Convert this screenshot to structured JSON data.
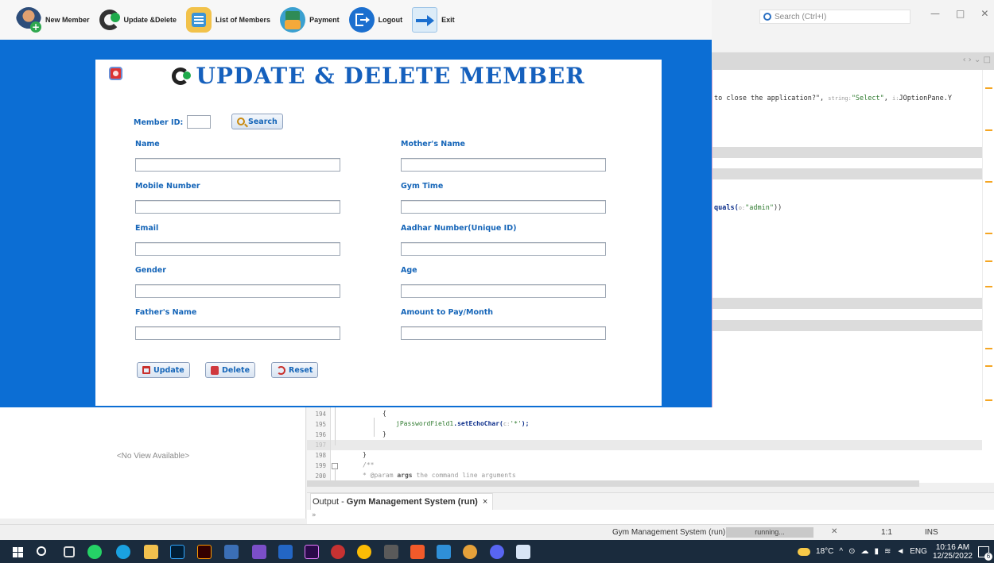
{
  "app_toolbar": {
    "buttons": [
      {
        "label": "New Member",
        "icon": "add-user-icon"
      },
      {
        "label": "Update &Delete",
        "icon": "refresh-icon"
      },
      {
        "label": "List of Members",
        "icon": "list-icon"
      },
      {
        "label": "Payment",
        "icon": "money-icon"
      },
      {
        "label": "Logout",
        "icon": "logout-icon"
      },
      {
        "label": "Exit",
        "icon": "exit-arrow-icon"
      }
    ]
  },
  "dialog": {
    "title": "UPDATE & DELETE MEMBER",
    "member_id_label": "Member ID:",
    "member_id_value": "",
    "search_button": "Search",
    "fields": {
      "name": {
        "label": "Name",
        "value": ""
      },
      "mothers_name": {
        "label": "Mother's Name",
        "value": ""
      },
      "mobile": {
        "label": "Mobile Number",
        "value": ""
      },
      "gym_time": {
        "label": "Gym Time",
        "value": ""
      },
      "email": {
        "label": "Email",
        "value": ""
      },
      "aadhar": {
        "label": "Aadhar Number(Unique ID)",
        "value": ""
      },
      "gender": {
        "label": "Gender",
        "value": ""
      },
      "age": {
        "label": "Age",
        "value": ""
      },
      "fathers_name": {
        "label": "Father's Name",
        "value": ""
      },
      "amount": {
        "label": "Amount to Pay/Month",
        "value": ""
      }
    },
    "buttons": {
      "update": "Update",
      "delete": "Delete",
      "reset": "Reset"
    }
  },
  "ide": {
    "search_placeholder": "Search (Ctrl+I)",
    "code_right": {
      "line1_pre": "to close the application?\", ",
      "line1_hint": "string:",
      "line1_str": "\"Select\"",
      "line1_post": ", ",
      "line1_hint2": "i:",
      "line1_tail": "JOptionPane.Y",
      "line2_pre": "quals(",
      "line2_hint": "o:",
      "line2_str": "\"admin\"",
      "line2_post": "))"
    },
    "code_bottom": {
      "line_numbers": [
        "194",
        "195",
        "196",
        "197",
        "198",
        "199",
        "200"
      ],
      "brace_open": "{",
      "line195_field": "jPasswordField1",
      "line195_call": ".setEchoChar(",
      "line195_hint": "c:",
      "line195_arg": "'*'",
      "line195_end": ");",
      "brace_close": "}",
      "brace_close2": "}",
      "comment_open": "/**",
      "comment_param_pre": " * @param ",
      "comment_param_kw": "args",
      "comment_param_post": " the command line arguments"
    },
    "navigator_empty": "<No View Available>",
    "output_tab_prefix": "Output - ",
    "output_tab_title": "Gym Management System (run)",
    "output_tab_close": "×",
    "output_chevron": "»",
    "status": {
      "project": "Gym Management System (run)",
      "progress_text": "running...",
      "position": "1:1",
      "mode": "INS"
    }
  },
  "taskbar": {
    "temperature": "18°C",
    "language": "ENG",
    "time": "10:16 AM",
    "date": "12/25/2022",
    "notification_count": "6"
  }
}
